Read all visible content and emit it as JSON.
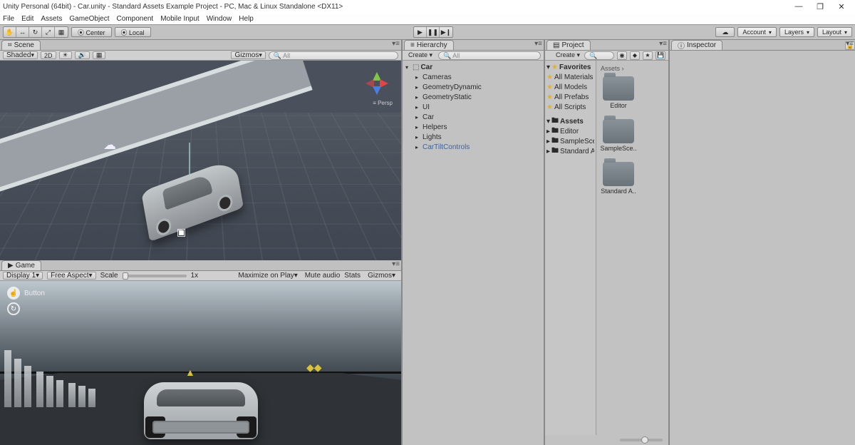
{
  "window": {
    "title": "Unity Personal (64bit) - Car.unity - Standard Assets Example Project - PC, Mac & Linux Standalone <DX11>",
    "min": "—",
    "max": "❐",
    "close": "✕"
  },
  "menus": [
    "File",
    "Edit",
    "Assets",
    "GameObject",
    "Component",
    "Mobile Input",
    "Window",
    "Help"
  ],
  "toolbar": {
    "handTools": [
      "✋",
      "↔",
      "↻",
      "⤢",
      "▦"
    ],
    "pivot_center": "⦿ Center",
    "pivot_local": "⦿ Local",
    "play": "▶",
    "pause": "❚❚",
    "step": "▶❙",
    "cloud": "☁",
    "account": "Account",
    "layers": "Layers",
    "layout": "Layout"
  },
  "sceneTab": "Scene",
  "scene_toolbar": {
    "shaded": "Shaded",
    "twod": "2D",
    "light": "☀",
    "audio": "🔊",
    "fx": "▦",
    "gizmos": "Gizmos",
    "search_ph": "All"
  },
  "gizmo_persp": "≡ Persp",
  "gameTab": "Game",
  "game_toolbar": {
    "display": "Display 1",
    "aspect": "Free Aspect",
    "scale_label": "Scale",
    "scale_val": "1x",
    "maxplay": "Maximize on Play",
    "muteaudio": "Mute audio",
    "stats": "Stats",
    "gizmos": "Gizmos"
  },
  "game_ui_button": "Button",
  "hierarchy": {
    "tab": "Hierarchy",
    "create": "Create ▾",
    "search_ph": "All",
    "root": "Car",
    "items": [
      "Cameras",
      "GeometryDynamic",
      "GeometryStatic",
      "UI",
      "Car",
      "Helpers",
      "Lights"
    ],
    "sel": "CarTiltControls"
  },
  "project": {
    "tab": "Project",
    "create": "Create ▾",
    "search_ph": "",
    "favorites_hdr": "Favorites",
    "favorites": [
      "All Materials",
      "All Models",
      "All Prefabs",
      "All Scripts"
    ],
    "assets_hdr": "Assets",
    "assets_tree": [
      "Editor",
      "SampleScen",
      "Standard As"
    ],
    "breadcrumb": "Assets ›",
    "folders": [
      "Editor",
      "SampleSce..",
      "Standard A.."
    ]
  },
  "inspector": {
    "tab": "Inspector",
    "lock": "🔒"
  },
  "paneMenuGlyph": "▾≡"
}
